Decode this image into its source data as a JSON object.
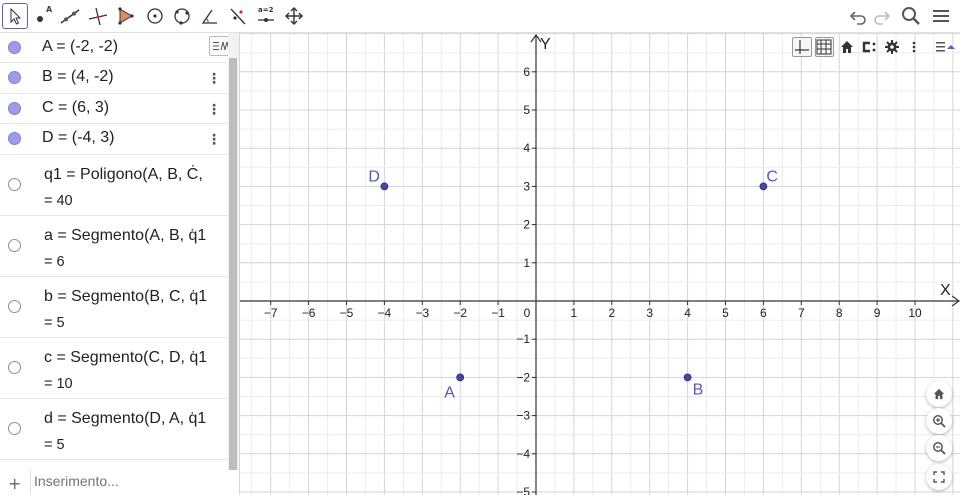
{
  "toolbar": {
    "tools": [
      {
        "name": "move",
        "icon": "cursor-arrow-icon",
        "selected": true
      },
      {
        "name": "point",
        "icon": "point-tool-icon",
        "label": "A"
      },
      {
        "name": "line",
        "icon": "line-tool-icon"
      },
      {
        "name": "perpendicular",
        "icon": "perpendicular-tool-icon"
      },
      {
        "name": "polygon",
        "icon": "polygon-tool-icon"
      },
      {
        "name": "circle-center",
        "icon": "circle-center-tool-icon"
      },
      {
        "name": "circle-three-points",
        "icon": "circle-three-points-tool-icon"
      },
      {
        "name": "angle",
        "icon": "angle-tool-icon"
      },
      {
        "name": "reflect",
        "icon": "reflect-tool-icon"
      },
      {
        "name": "slider",
        "icon": "slider-tool-icon",
        "label": "a=2"
      },
      {
        "name": "move-graphics",
        "icon": "move-graphics-tool-icon"
      }
    ],
    "right_icons": [
      "undo-icon",
      "redo-icon",
      "search-icon",
      "menu-icon"
    ]
  },
  "algebra": {
    "rows": [
      {
        "definition": "A = (-2, -2)",
        "visible": true
      },
      {
        "definition": "B = (4, -2)",
        "visible": true
      },
      {
        "definition": "C = (6, 3)",
        "visible": true
      },
      {
        "definition": "D = (-4, 3)",
        "visible": true
      },
      {
        "definition": "q1 = Poligono(A, B, Ċ,",
        "value": "= 40",
        "visible": false
      },
      {
        "definition": "a = Segmento(A, B, q̇1",
        "value": "= 6",
        "visible": false
      },
      {
        "definition": "b = Segmento(B, C, q̇1",
        "value": "= 5",
        "visible": false
      },
      {
        "definition": "c = Segmento(C, D, q̇1",
        "value": "= 10",
        "visible": false
      },
      {
        "definition": "d = Segmento(D, A, q̇1",
        "value": "= 5",
        "visible": false
      }
    ],
    "kebab": "⋮",
    "input_placeholder": "Inserimento...",
    "input_plus": "+"
  },
  "graphics": {
    "x_axis_label": "X",
    "y_axis_label": "Y",
    "x_ticks": [
      -7,
      -6,
      -5,
      -4,
      -3,
      -2,
      -1,
      0,
      1,
      2,
      3,
      4,
      5,
      6,
      7,
      8,
      9,
      10
    ],
    "y_ticks": [
      6,
      5,
      4,
      3,
      2,
      1,
      -1,
      -2,
      -3,
      -4,
      -5
    ],
    "x_range": [
      -7.5,
      10.75
    ],
    "y_range": [
      -5.2,
      6.9
    ],
    "points": [
      {
        "name": "A",
        "x": -2,
        "y": -2
      },
      {
        "name": "B",
        "x": 4,
        "y": -2
      },
      {
        "name": "C",
        "x": 6,
        "y": 3
      },
      {
        "name": "D",
        "x": -4,
        "y": 3
      }
    ],
    "point_color": "#4545b0",
    "label_color": "#5555cc",
    "toolbar_icons": [
      "axes-icon",
      "grid-icon",
      "home-icon",
      "capture-icon",
      "gear-icon",
      "more-icon"
    ],
    "zoom_buttons": [
      "home-icon",
      "zoom-in-icon",
      "zoom-out-icon",
      "fullscreen-icon"
    ]
  }
}
